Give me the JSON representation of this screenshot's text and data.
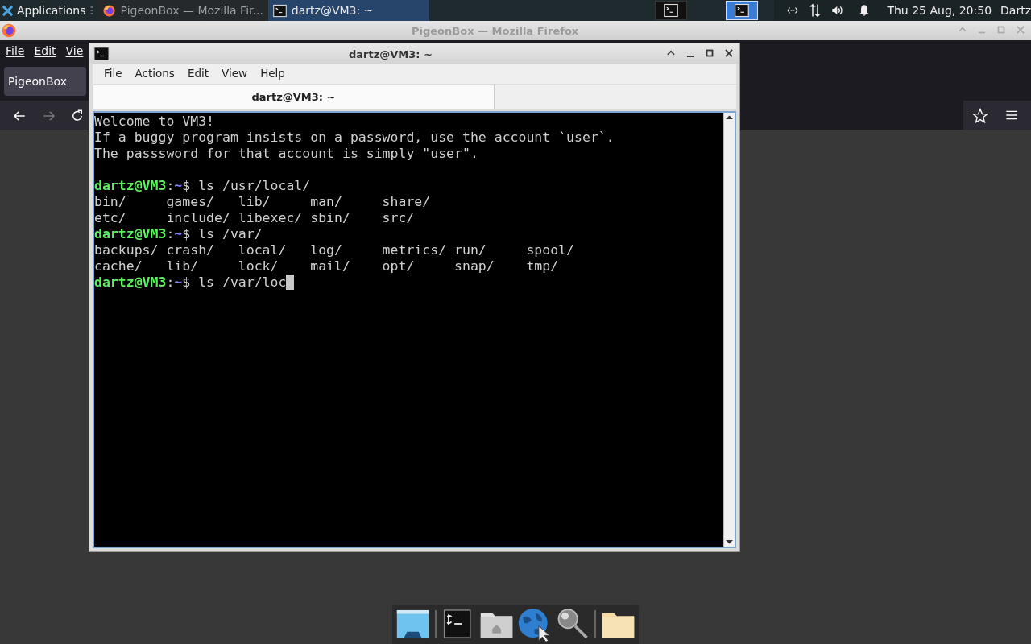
{
  "top_panel": {
    "applications_label": "Applications",
    "tasks": [
      {
        "kind": "firefox",
        "label": "PigeonBox — Mozilla Fir...",
        "selected": false
      },
      {
        "kind": "terminal",
        "label": "dartz@VM3: ~",
        "selected": true
      }
    ],
    "workspaces": [
      {
        "selected": false
      },
      {
        "selected": true
      }
    ],
    "clock": "Thu 25 Aug, 20:50",
    "user": "Dartz"
  },
  "firefox": {
    "title": "PigeonBox — Mozilla Firefox",
    "menu": [
      "File",
      "Edit",
      "Vie"
    ],
    "tab": "PigeonBox"
  },
  "terminal": {
    "title": "dartz@VM3: ~",
    "menu": [
      "File",
      "Actions",
      "Edit",
      "View",
      "Help"
    ],
    "tab": "dartz@VM3: ~",
    "lines": [
      {
        "kind": "output",
        "text": "Welcome to VM3!"
      },
      {
        "kind": "output",
        "text": "If a buggy program insists on a password, use the account `user`."
      },
      {
        "kind": "output",
        "text": "The passsword for that account is simply \"user\"."
      },
      {
        "kind": "blank"
      },
      {
        "kind": "prompt",
        "user": "dartz@VM3",
        "colon": ":",
        "path": "~",
        "command": "$ ls /usr/local/",
        "cursor": false
      },
      {
        "kind": "output",
        "text": "bin/     games/   lib/     man/     share/"
      },
      {
        "kind": "output",
        "text": "etc/     include/ libexec/ sbin/    src/"
      },
      {
        "kind": "prompt",
        "user": "dartz@VM3",
        "colon": ":",
        "path": "~",
        "command": "$ ls /var/",
        "cursor": false
      },
      {
        "kind": "output",
        "text": "backups/ crash/   local/   log/     metrics/ run/     spool/"
      },
      {
        "kind": "output",
        "text": "cache/   lib/     lock/    mail/    opt/     snap/    tmp/"
      },
      {
        "kind": "prompt",
        "user": "dartz@VM3",
        "colon": ":",
        "path": "~",
        "command": "$ ls /var/loc",
        "cursor": true
      }
    ]
  },
  "dock": [
    {
      "kind": "desktop"
    },
    {
      "kind": "separator"
    },
    {
      "kind": "terminal"
    },
    {
      "kind": "home"
    },
    {
      "kind": "globe"
    },
    {
      "kind": "search"
    },
    {
      "kind": "separator"
    },
    {
      "kind": "folder"
    }
  ]
}
